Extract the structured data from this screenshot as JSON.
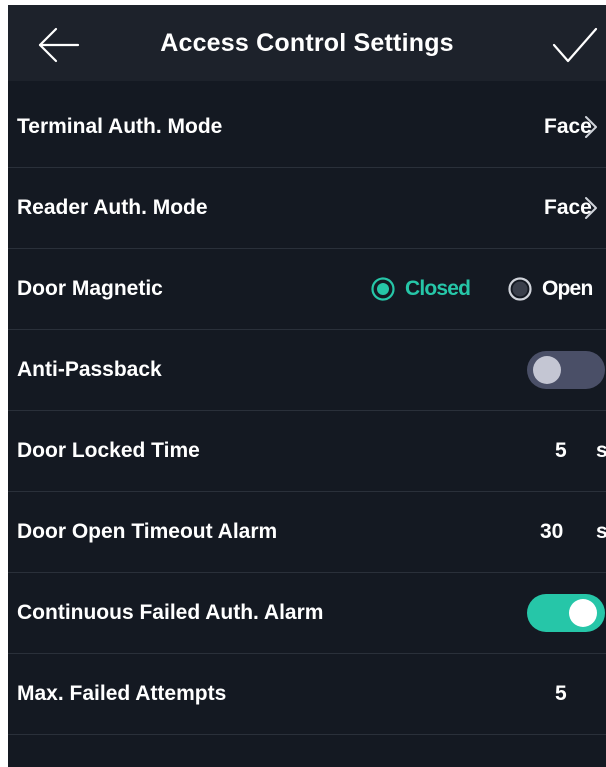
{
  "header": {
    "title": "Access Control Settings",
    "back_icon": "arrow-left-icon",
    "confirm_icon": "checkmark-icon"
  },
  "colors": {
    "background": "#141922",
    "header": "#1d222b",
    "accent": "#26c6a8",
    "toggle_off_track": "#4a4f67",
    "toggle_off_knob": "#c4c6d3",
    "divider": "#2a303a",
    "text": "#ffffff"
  },
  "settings": {
    "terminal_auth_mode": {
      "label": "Terminal Auth. Mode",
      "value": "Face"
    },
    "reader_auth_mode": {
      "label": "Reader Auth. Mode",
      "value": "Face"
    },
    "door_magnetic": {
      "label": "Door Magnetic",
      "options": [
        "Closed",
        "Open"
      ],
      "selected": "Closed"
    },
    "anti_passback": {
      "label": "Anti-Passback",
      "enabled": false
    },
    "door_locked_time": {
      "label": "Door Locked Time",
      "value": "5",
      "unit": "s"
    },
    "door_open_timeout_alarm": {
      "label": "Door Open Timeout Alarm",
      "value": "30",
      "unit": "s"
    },
    "continuous_failed_auth_alarm": {
      "label": "Continuous Failed Auth. Alarm",
      "enabled": true
    },
    "max_failed_attempts": {
      "label": "Max. Failed Attempts",
      "value": "5"
    }
  }
}
